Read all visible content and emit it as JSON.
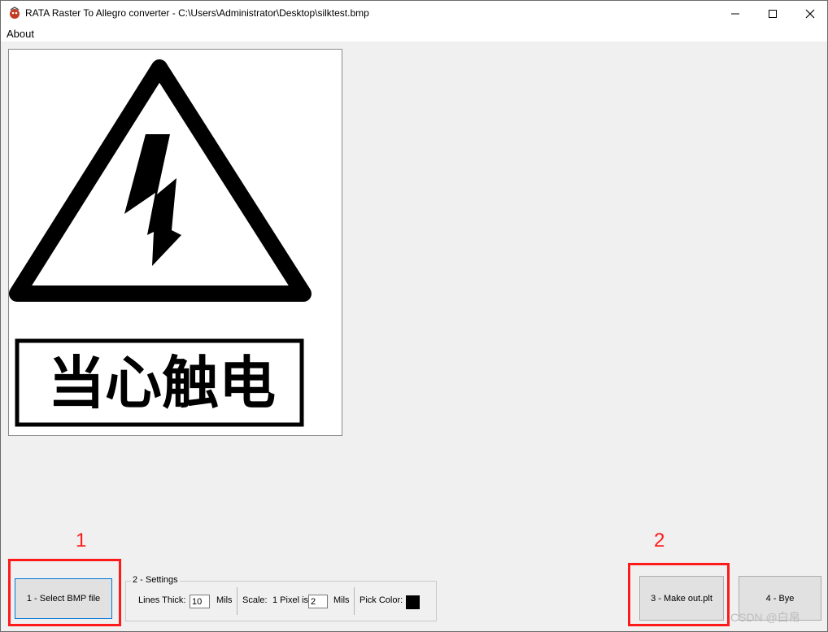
{
  "window": {
    "title": "RATA Raster To Allegro converter - C:\\Users\\Administrator\\Desktop\\silktest.bmp"
  },
  "menu": {
    "items": [
      {
        "label": "About"
      }
    ]
  },
  "image_preview": {
    "text": "当心触电"
  },
  "buttons": {
    "select_bmp": "1 - Select BMP file",
    "make_out": "3 - Make out.plt",
    "bye": "4 - Bye"
  },
  "settings": {
    "legend": "2 - Settings",
    "lines_thick_label": "Lines Thick:",
    "lines_thick_value": "10",
    "lines_thick_unit": "Mils",
    "scale_label": "Scale:",
    "pixel_label": "1 Pixel is",
    "pixel_value": "2",
    "pixel_unit": "Mils",
    "pick_color_label": "Pick Color:",
    "pick_color_value": "#000000"
  },
  "annotations": {
    "one": "1",
    "two": "2"
  },
  "watermark": "CSDN @白帛",
  "colors": {
    "annotation": "#ff1a1a",
    "focus": "#0078d7"
  }
}
